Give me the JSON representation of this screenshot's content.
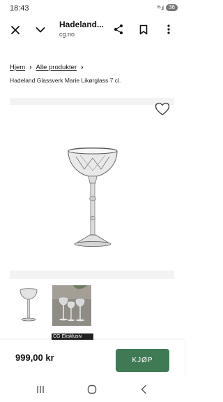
{
  "status": {
    "time": "18:43",
    "icons": [
      "nfc-icon",
      "signal-icon",
      "battery-icon"
    ],
    "signal_text": "ᵀᴮ .ıl",
    "battery": "36"
  },
  "browser": {
    "page_title": "Hadeland...",
    "domain": "cg.no"
  },
  "breadcrumb": {
    "items": [
      "Hjem",
      "Alle produkter"
    ]
  },
  "product": {
    "name": "Hadeland Glassverk Marie Likørglass 7 cl.",
    "price": "999,00 kr",
    "thumb_badge": "CG Eksklusiv"
  },
  "cta": {
    "buy_label": "KJØP"
  },
  "colors": {
    "accent": "#3f7a54",
    "band": "#f3f3f3",
    "badge_bg": "#222222"
  }
}
